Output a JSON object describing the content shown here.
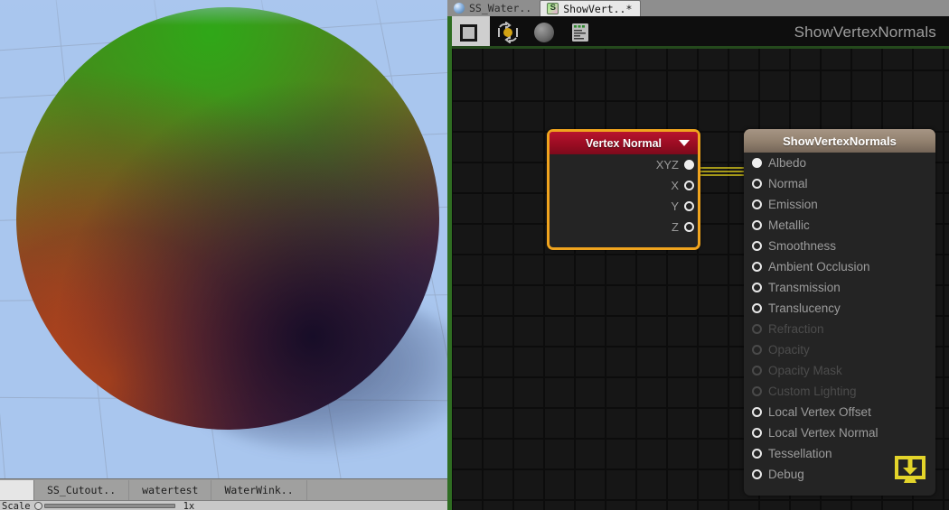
{
  "scene": {
    "name": "scene-preview",
    "background_color": "#a9c6ee",
    "object": "shaded-sphere",
    "bottom_tabs": [
      {
        "label": "SS_Cutout.."
      },
      {
        "label": "watertest"
      },
      {
        "label": "WaterWink.."
      }
    ],
    "scale_label": "Scale",
    "scale_value": "1x"
  },
  "editor": {
    "tabs": [
      {
        "label": "SS_Water..",
        "icon": "sphere-icon",
        "active": false
      },
      {
        "label": "ShowVert..*",
        "icon": "shader-icon",
        "active": true
      }
    ],
    "toolbar": [
      {
        "name": "stop-button",
        "icon": "square-icon",
        "active": true
      },
      {
        "name": "update-button",
        "icon": "refresh-sphere-icon",
        "active": false
      },
      {
        "name": "preview-button",
        "icon": "grey-sphere-icon",
        "active": false
      },
      {
        "name": "code-button",
        "icon": "document-code-icon",
        "active": false
      }
    ],
    "graph_title": "ShowVertexNormals",
    "accent_color": "#f0a41e",
    "wire_color": "#d4c41a"
  },
  "nodes": {
    "vertex_normal": {
      "title": "Vertex Normal",
      "header_color": "#9a0c22",
      "selected": true,
      "outputs": [
        {
          "label": "XYZ",
          "connected": true
        },
        {
          "label": "X",
          "connected": false
        },
        {
          "label": "Y",
          "connected": false
        },
        {
          "label": "Z",
          "connected": false
        }
      ]
    },
    "master": {
      "title": "ShowVertexNormals",
      "header_color": "#92816f",
      "inputs": [
        {
          "label": "Albedo",
          "connected": true,
          "enabled": true
        },
        {
          "label": "Normal",
          "connected": false,
          "enabled": true
        },
        {
          "label": "Emission",
          "connected": false,
          "enabled": true
        },
        {
          "label": "Metallic",
          "connected": false,
          "enabled": true
        },
        {
          "label": "Smoothness",
          "connected": false,
          "enabled": true
        },
        {
          "label": "Ambient Occlusion",
          "connected": false,
          "enabled": true
        },
        {
          "label": "Transmission",
          "connected": false,
          "enabled": true
        },
        {
          "label": "Translucency",
          "connected": false,
          "enabled": true
        },
        {
          "label": "Refraction",
          "connected": false,
          "enabled": false
        },
        {
          "label": "Opacity",
          "connected": false,
          "enabled": false
        },
        {
          "label": "Opacity Mask",
          "connected": false,
          "enabled": false
        },
        {
          "label": "Custom Lighting",
          "connected": false,
          "enabled": false
        },
        {
          "label": "Local Vertex Offset",
          "connected": false,
          "enabled": true
        },
        {
          "label": "Local Vertex Normal",
          "connected": false,
          "enabled": true
        },
        {
          "label": "Tessellation",
          "connected": false,
          "enabled": true
        },
        {
          "label": "Debug",
          "connected": false,
          "enabled": true
        }
      ],
      "compile_icon": "download-to-monitor-icon"
    }
  }
}
